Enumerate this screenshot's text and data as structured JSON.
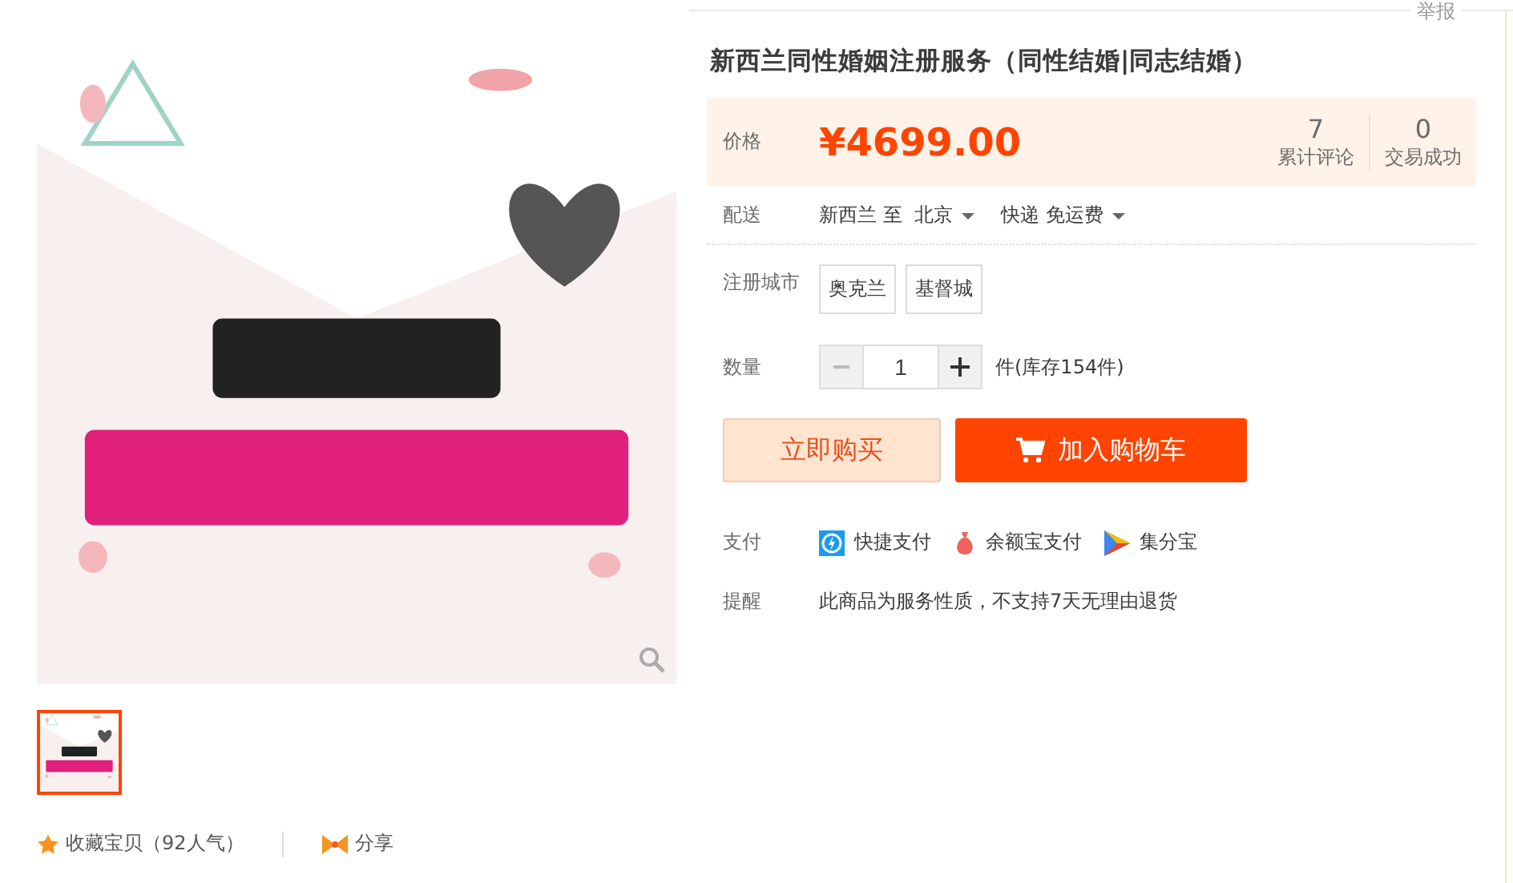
{
  "report_link": "举报",
  "gallery": {
    "thumbnails": [
      {
        "kind": "picture",
        "selected": true
      }
    ]
  },
  "actions": {
    "favorite": "收藏宝贝（92人气）",
    "share": "分享"
  },
  "title": "新西兰同性婚姻注册服务（同性结婚|同志结婚）",
  "price": {
    "label": "价格",
    "value": "¥4699.00"
  },
  "stats": [
    {
      "value": "7",
      "label": "累计评论"
    },
    {
      "value": "0",
      "label": "交易成功"
    }
  ],
  "delivery": {
    "label": "配送",
    "route": "新西兰 至  北京",
    "shipping": "快递 免运费"
  },
  "city": {
    "label": "注册城市",
    "options": [
      {
        "label": "奥克兰",
        "selected": false
      },
      {
        "label": "基督城",
        "selected": false
      }
    ]
  },
  "quantity": {
    "label": "数量",
    "value": "1",
    "minus_disabled": true,
    "stock": "件(库存154件)"
  },
  "buttons": {
    "buy_now": "立即购买",
    "add_to_cart": "加入购物车"
  },
  "payment": {
    "label": "支付",
    "methods": [
      {
        "kind": "express",
        "label": "快捷支付"
      },
      {
        "kind": "balance",
        "label": "余额宝支付"
      },
      {
        "kind": "points",
        "label": "集分宝"
      }
    ]
  },
  "notice": {
    "label": "提醒",
    "text": "此商品为服务性质，不支持7天无理由退货"
  }
}
